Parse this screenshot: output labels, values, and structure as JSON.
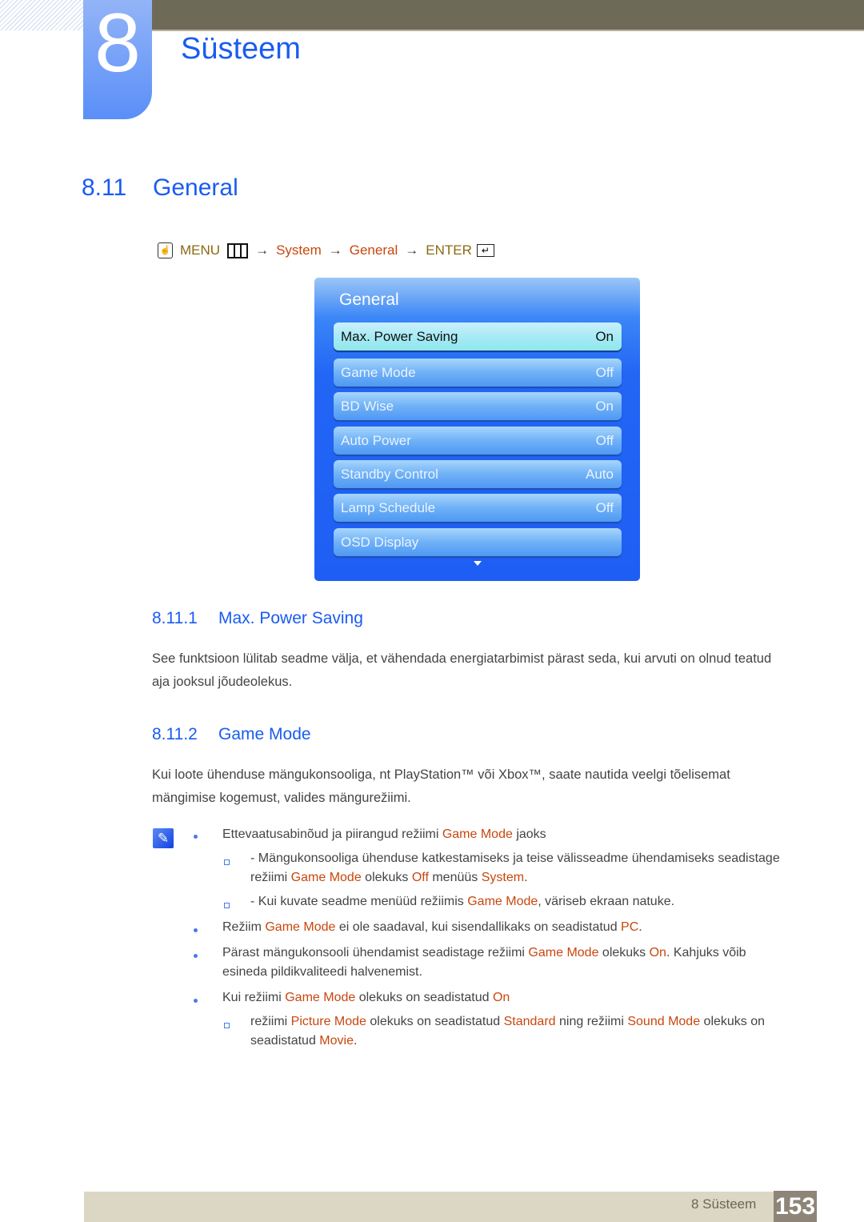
{
  "chapter": {
    "number": "8",
    "title": "Süsteem"
  },
  "section": {
    "number": "8.11",
    "title": "General"
  },
  "menu_path": {
    "menu_label": "MENU",
    "arrow": "→",
    "system_label": "System",
    "general_label": "General",
    "enter_label": "ENTER",
    "icons": [
      "hand-remote-icon",
      "menu-grid-icon",
      "enter-icon"
    ]
  },
  "osd": {
    "title": "General",
    "items": [
      {
        "label": "Max. Power Saving",
        "value": "On",
        "selected": true
      },
      {
        "label": "Game Mode",
        "value": "Off"
      },
      {
        "label": "BD Wise",
        "value": "On"
      },
      {
        "label": "Auto Power",
        "value": "Off"
      },
      {
        "label": "Standby Control",
        "value": "Auto"
      },
      {
        "label": "Lamp Schedule",
        "value": "Off"
      },
      {
        "label": "OSD Display",
        "value": ""
      }
    ],
    "scroll_icon": "triangle-down-icon"
  },
  "sub1": {
    "number": "8.11.1",
    "title": "Max. Power Saving",
    "text": "See funktsioon lülitab seadme välja, et vähendada energiatarbimist pärast seda, kui arvuti on olnud teatud aja jooksul jõudeolekus."
  },
  "sub2": {
    "number": "8.11.2",
    "title": "Game Mode",
    "text": "Kui loote ühenduse mängukonsooliga, nt PlayStation™ või Xbox™, saate nautida veelgi tõelisemat mängimise kogemust, valides mängurežiimi."
  },
  "notes": {
    "icon": "note-pencil-icon",
    "b1": {
      "pre": "Ettevaatusabinõud ja piirangud režiimi ",
      "hl": "Game Mode",
      "post": " jaoks"
    },
    "s1": {
      "a": "- Mängukonsooliga ühenduse katkestamiseks ja teise välisseadme ühendamiseks seadistage",
      "b": "režiimi ",
      "hl1": "Game Mode",
      "c": " olekuks ",
      "hl2": "Off",
      "d": " menüüs ",
      "hl3": "System",
      "e": "."
    },
    "s2": {
      "a": "- Kui kuvate seadme menüüd režiimis ",
      "hl": "Game Mode",
      "b": ", väriseb ekraan natuke."
    },
    "b2": {
      "a": "Režiim ",
      "hl1": "Game Mode",
      "b": " ei ole saadaval, kui sisendallikaks on seadistatud ",
      "hl2": "PC",
      "c": "."
    },
    "b3": {
      "a": "Pärast mängukonsooli ühendamist seadistage režiimi ",
      "hl1": "Game Mode",
      "b": " olekuks ",
      "hl2": "On",
      "c": ". Kahjuks võib",
      "d": "esineda pildikvaliteedi halvenemist."
    },
    "b4": {
      "a": "Kui režiimi ",
      "hl1": "Game Mode",
      "b": " olekuks on seadistatud ",
      "hl2": "On"
    },
    "s3": {
      "a": "režiimi ",
      "hl1": "Picture Mode",
      "b": " olekuks on seadistatud ",
      "hl2": "Standard",
      "c": " ning režiimi ",
      "hl3": "Sound Mode",
      "d": " olekuks on",
      "e": "seadistatud ",
      "hl4": "Movie",
      "f": "."
    }
  },
  "footer": {
    "label": "8 Süsteem",
    "page": "153"
  }
}
